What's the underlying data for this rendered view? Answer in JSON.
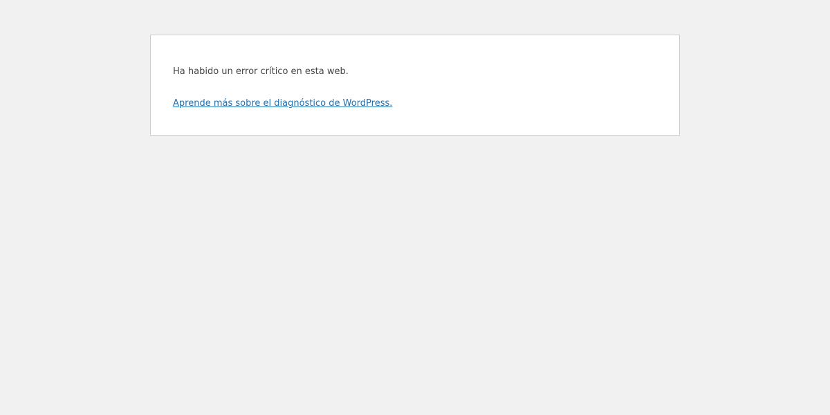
{
  "error_page": {
    "message": "Ha habido un error crítico en esta web.",
    "link_text": "Aprende más sobre el diagnóstico de WordPress."
  },
  "colors": {
    "background": "#f1f1f1",
    "box_background": "#ffffff",
    "box_border": "#cccccc",
    "text": "#444444",
    "link": "#2271b1"
  }
}
